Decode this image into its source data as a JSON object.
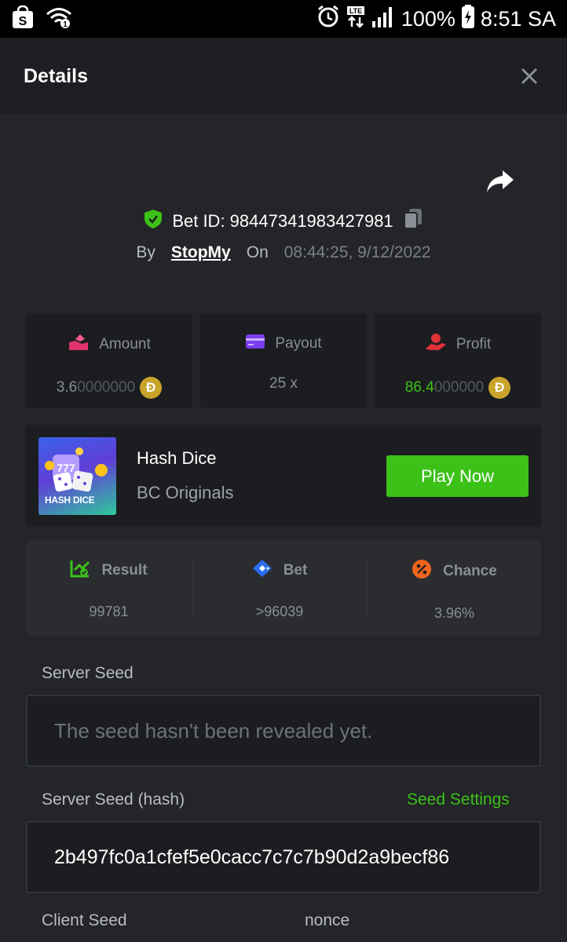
{
  "status_bar": {
    "battery": "100%",
    "time": "8:51 SA",
    "network": "LTE"
  },
  "header": {
    "title": "Details"
  },
  "bet": {
    "id_text": "Bet ID: 98447341983427981",
    "by_label": "By",
    "username": "StopMy",
    "on_label": "On",
    "datetime": "08:44:25, 9/12/2022"
  },
  "stats": {
    "amount_label": "Amount",
    "amount_main": "3.6",
    "amount_dim": "0000000",
    "payout_label": "Payout",
    "payout_value": "25 x",
    "profit_label": "Profit",
    "profit_main": "86.4",
    "profit_dim": "000000",
    "coin_symbol": "Đ"
  },
  "game": {
    "title": "Hash Dice",
    "subtitle": "BC Originals",
    "thumb_text": "HASH DICE",
    "play_label": "Play Now"
  },
  "results": {
    "result_label": "Result",
    "result_value": "99781",
    "bet_label": "Bet",
    "bet_value": ">96039",
    "chance_label": "Chance",
    "chance_value": "3.96%"
  },
  "seeds": {
    "server_seed_label": "Server Seed",
    "server_seed_value": "The seed hasn't been revealed yet.",
    "server_hash_label": "Server Seed (hash)",
    "seed_settings_label": "Seed Settings",
    "server_hash_value": "2b497fc0a1cfef5e0cacc7c7c7b90d2a9becf86",
    "client_seed_label": "Client Seed",
    "nonce_label": "nonce"
  },
  "colors": {
    "accent_green": "#3bc117",
    "background": "#232528",
    "card": "#1b1d20"
  }
}
